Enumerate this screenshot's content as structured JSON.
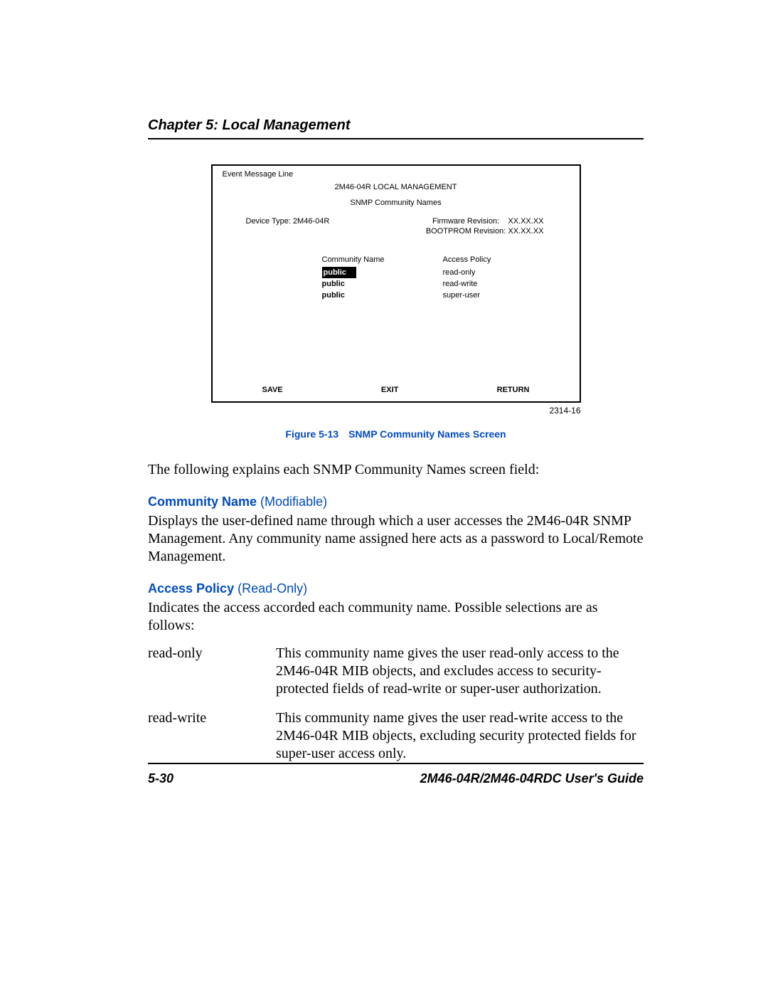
{
  "header": {
    "chapter_title": "Chapter 5: Local Management"
  },
  "screen": {
    "event_message_line": "Event Message Line",
    "title": "2M46-04R LOCAL MANAGEMENT",
    "subtitle": "SNMP Community Names",
    "device_type_label": "Device Type: 2M46-04R",
    "firmware_label": "Firmware Revision:",
    "firmware_value": "XX.XX.XX",
    "bootprom_label": "BOOTPROM Revision:",
    "bootprom_value": "XX.XX.XX",
    "col1_header": "Community Name",
    "col2_header": "Access Policy",
    "rows": [
      {
        "name": "public",
        "policy": "read-only",
        "selected": true
      },
      {
        "name": "public",
        "policy": "read-write",
        "selected": false
      },
      {
        "name": "public",
        "policy": "super-user",
        "selected": false
      }
    ],
    "save_btn": "SAVE",
    "exit_btn": "EXIT",
    "return_btn": "RETURN"
  },
  "figure": {
    "number": "2314-16",
    "caption": "Figure 5-13 SNMP Community Names Screen"
  },
  "intro_text": "The following explains each SNMP Community Names screen field:",
  "fields": {
    "community_name": {
      "label": "Community Name",
      "modifier": "(Modifiable)",
      "desc": "Displays the user-defined name through which a user accesses the 2M46-04R SNMP Management. Any community name assigned here acts as a password to Local/Remote Management."
    },
    "access_policy": {
      "label": "Access Policy",
      "modifier": "(Read-Only)",
      "desc": "Indicates the access accorded each community name. Possible selections are as follows:"
    }
  },
  "access_definitions": [
    {
      "term": "read-only",
      "desc": "This community name gives the user read-only access to the 2M46-04R MIB objects, and excludes access to security-protected fields of read-write or super-user authorization."
    },
    {
      "term": "read-write",
      "desc": "This community name gives the user read-write access to the 2M46-04R MIB objects, excluding security protected fields for super-user access only."
    }
  ],
  "footer": {
    "page_number": "5-30",
    "doc_title": "2M46-04R/2M46-04RDC User's Guide"
  }
}
